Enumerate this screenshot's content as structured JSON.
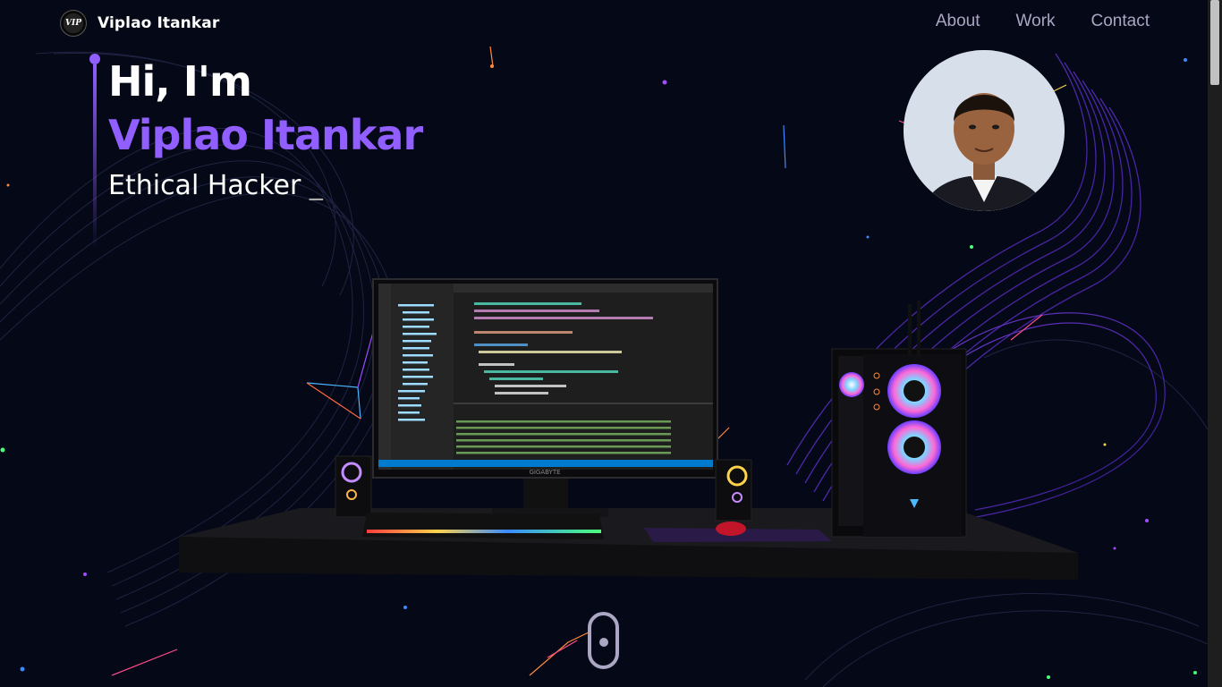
{
  "nav": {
    "logo_text": "VIP",
    "brand": "Viplao Itankar",
    "links": [
      "About",
      "Work",
      "Contact"
    ]
  },
  "hero": {
    "greeting": "Hi, I'm",
    "name": "Viplao Itankar",
    "role": "Ethical Hacker",
    "cursor": "_"
  },
  "monitor": {
    "brand": "GIGABYTE"
  },
  "colors": {
    "background": "#050816",
    "accent": "#915eff",
    "nav_text": "#aaa6c3"
  }
}
